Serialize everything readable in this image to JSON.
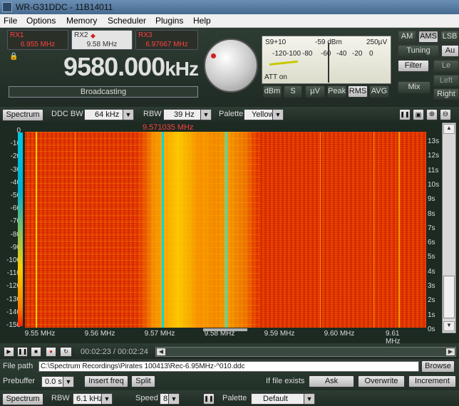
{
  "window": {
    "title": "WR-G31DDC - 11B14011"
  },
  "menu": [
    "File",
    "Options",
    "Memory",
    "Scheduler",
    "Plugins",
    "Help"
  ],
  "receivers": [
    {
      "name": "RX1",
      "freq": "6.955 MHz",
      "active": false
    },
    {
      "name": "RX2",
      "freq": "9.58 MHz",
      "active": true
    },
    {
      "name": "RX3",
      "freq": "6.97667 MHz",
      "active": false
    }
  ],
  "frequency": {
    "value": "9580.000",
    "unit": "kHz",
    "mode_label": "Broadcasting"
  },
  "smeter": {
    "top_left": "S9+10",
    "top_mid": "-59 dBm",
    "top_right": "250µV",
    "scale": [
      "-120",
      "-100",
      "-80",
      "-60",
      "-40",
      "-20",
      "0"
    ],
    "att": "ATT on",
    "buttons": [
      "dBm",
      "S",
      "µV",
      "Peak",
      "RMS",
      "AVG"
    ]
  },
  "demod": {
    "modes": [
      "AM",
      "AMS",
      "LSB"
    ],
    "buttons": {
      "tuning": "Tuning",
      "au": "Au",
      "filter": "Filter",
      "mix": "Mix",
      "le": "Le",
      "left": "Left",
      "right": "Right"
    }
  },
  "spectrum_toolbar": {
    "spectrum": "Spectrum",
    "ddc_bw_label": "DDC BW",
    "ddc_bw_value": "64 kHz",
    "rbw_label": "RBW",
    "rbw_value": "39 Hz",
    "palette_label": "Palette",
    "palette_value": "Yellow"
  },
  "waterfall": {
    "marker_label": "9.571035 MHz",
    "db_scale": [
      "0",
      "-10",
      "-20",
      "-30",
      "-40",
      "-50",
      "-60",
      "-70",
      "-80",
      "-90",
      "-100",
      "-110",
      "-120",
      "-130",
      "-140",
      "-150"
    ],
    "time_scale": [
      "13s",
      "12s",
      "11s",
      "10s",
      "9s",
      "8s",
      "7s",
      "6s",
      "5s",
      "4s",
      "3s",
      "2s",
      "1s",
      "0s"
    ],
    "freq_scale": [
      "9.55 MHz",
      "9.56 MHz",
      "9.57 MHz",
      "9.58 MHz",
      "9.59 MHz",
      "9.60 MHz",
      "9.61 MHz"
    ],
    "colors": {
      "background": "#e03000",
      "hot": "#ffd000",
      "peak": "#00d8e8"
    }
  },
  "transport": {
    "time": "00:02:23 / 00:02:24"
  },
  "file": {
    "path_label": "File path",
    "path": "C:\\Spectrum Recordings\\Pirates 100413\\Rec-6.95MHz-^010.ddc",
    "browse": "Browse",
    "prebuffer_label": "Prebuffer",
    "prebuffer_value": "0.0 s",
    "insert_freq": "Insert freq",
    "split": "Split",
    "if_exists_label": "If file exists",
    "ask": "Ask",
    "overwrite": "Overwrite",
    "increment": "Increment"
  },
  "bottom": {
    "spectrum": "Spectrum",
    "rbw_label": "RBW",
    "rbw_value": "6.1 kHz",
    "speed_label": "Speed",
    "speed_value": "8",
    "palette_label": "Palette",
    "palette_value": "Default"
  }
}
